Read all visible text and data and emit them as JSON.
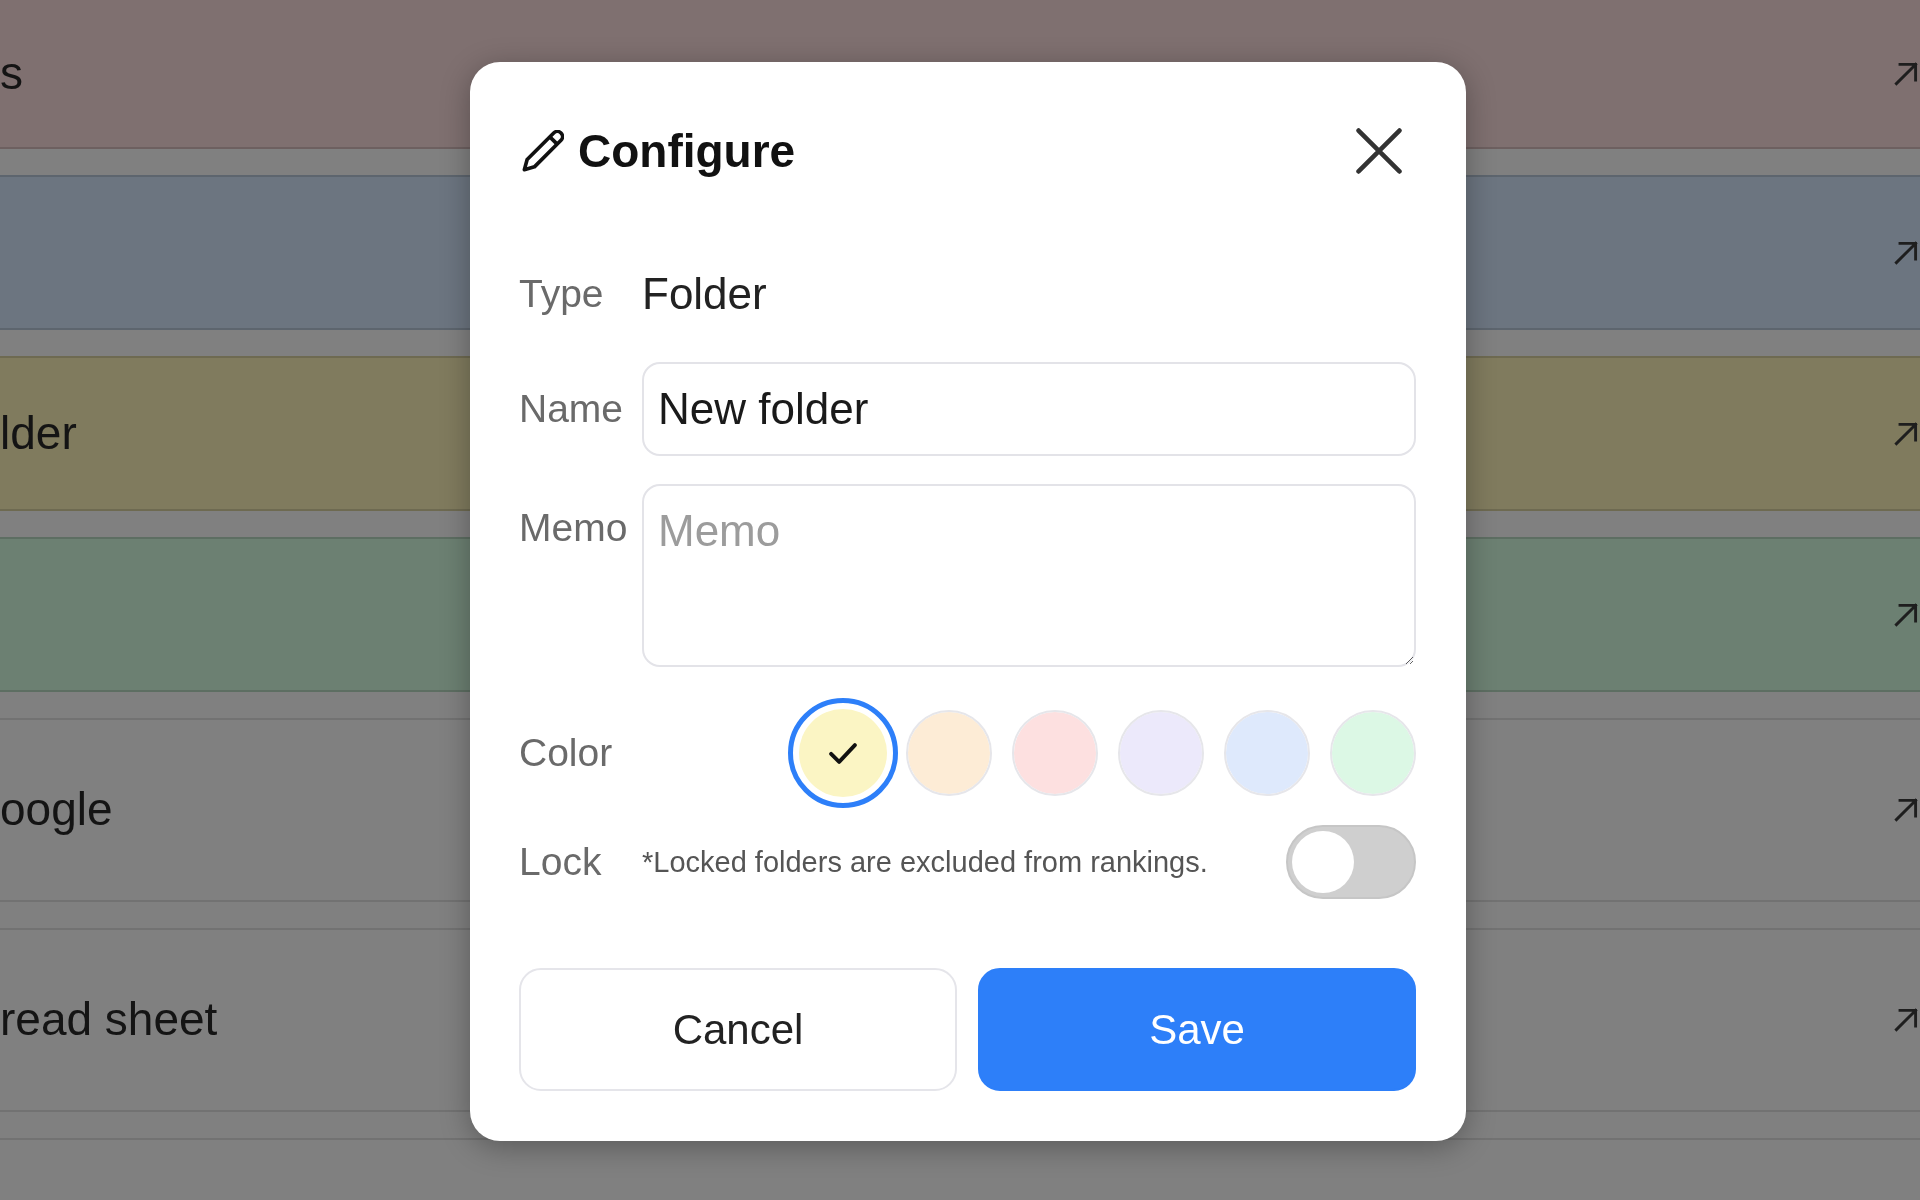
{
  "background_list": {
    "rows": [
      {
        "title": "s",
        "color": "#7f7070"
      },
      {
        "color": "#6c7580"
      },
      {
        "title": "lder",
        "color": "#807b5e"
      },
      {
        "color": "#6c8072"
      },
      {
        "title": "oogle"
      },
      {
        "title": "read sheet"
      }
    ]
  },
  "dialog": {
    "title": "Configure",
    "type": {
      "label": "Type",
      "value": "Folder"
    },
    "name": {
      "label": "Name",
      "value": "New folder"
    },
    "memo": {
      "label": "Memo",
      "placeholder": "Memo"
    },
    "color": {
      "label": "Color",
      "swatches": [
        {
          "color": "#fbf5c4",
          "selected": true
        },
        {
          "color": "#fdecd6",
          "selected": false
        },
        {
          "color": "#fde0e0",
          "selected": false
        },
        {
          "color": "#ece9fb",
          "selected": false
        },
        {
          "color": "#dee9fc",
          "selected": false
        },
        {
          "color": "#dcf8e5",
          "selected": false
        }
      ]
    },
    "lock": {
      "label": "Lock",
      "note": "*Locked folders are excluded from rankings.",
      "on": false
    },
    "buttons": [
      {
        "label": "Cancel",
        "kind": "secondary"
      },
      {
        "label": "Save",
        "kind": "primary"
      }
    ]
  }
}
